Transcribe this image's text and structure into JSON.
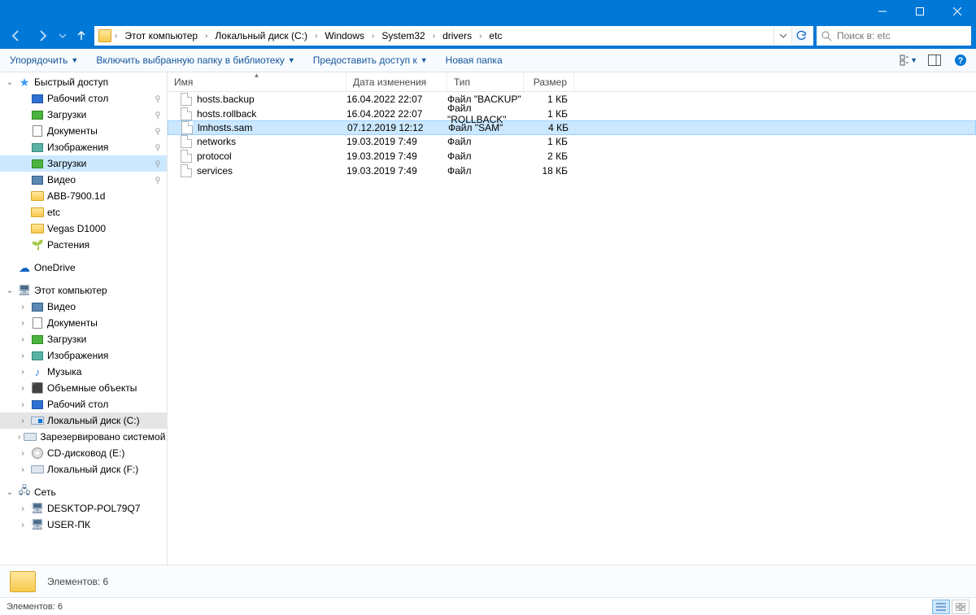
{
  "window": {
    "title": ""
  },
  "breadcrumb": {
    "items": [
      "Этот компьютер",
      "Локальный диск (C:)",
      "Windows",
      "System32",
      "drivers",
      "etc"
    ]
  },
  "search": {
    "placeholder": "Поиск в: etc"
  },
  "toolbar": {
    "organize": "Упорядочить",
    "library": "Включить выбранную папку в библиотеку",
    "share": "Предоставить доступ к",
    "newfolder": "Новая папка"
  },
  "columns": {
    "name": "Имя",
    "date": "Дата изменения",
    "type": "Тип",
    "size": "Размер"
  },
  "files": [
    {
      "name": "hosts.backup",
      "date": "16.04.2022 22:07",
      "type": "Файл \"BACKUP\"",
      "size": "1 КБ",
      "selected": false
    },
    {
      "name": "hosts.rollback",
      "date": "16.04.2022 22:07",
      "type": "Файл \"ROLLBACK\"",
      "size": "1 КБ",
      "selected": false
    },
    {
      "name": "lmhosts.sam",
      "date": "07.12.2019 12:12",
      "type": "Файл \"SAM\"",
      "size": "4 КБ",
      "selected": true
    },
    {
      "name": "networks",
      "date": "19.03.2019 7:49",
      "type": "Файл",
      "size": "1 КБ",
      "selected": false
    },
    {
      "name": "protocol",
      "date": "19.03.2019 7:49",
      "type": "Файл",
      "size": "2 КБ",
      "selected": false
    },
    {
      "name": "services",
      "date": "19.03.2019 7:49",
      "type": "Файл",
      "size": "18 КБ",
      "selected": false
    }
  ],
  "sidebar": {
    "quick": {
      "label": "Быстрый доступ",
      "items": [
        {
          "label": "Рабочий стол",
          "icon": "blue",
          "pin": true
        },
        {
          "label": "Загрузки",
          "icon": "green",
          "pin": true
        },
        {
          "label": "Документы",
          "icon": "doc",
          "pin": true
        },
        {
          "label": "Изображения",
          "icon": "pic",
          "pin": true
        },
        {
          "label": "Загрузки",
          "icon": "green",
          "pin": true,
          "selected": true
        },
        {
          "label": "Видео",
          "icon": "video",
          "pin": true
        },
        {
          "label": "ABB-7900.1d",
          "icon": "folder",
          "pin": false
        },
        {
          "label": "etc",
          "icon": "folder",
          "pin": false
        },
        {
          "label": "Vegas D1000",
          "icon": "folder",
          "pin": false
        },
        {
          "label": "Растения",
          "icon": "plant",
          "pin": false
        }
      ]
    },
    "onedrive": {
      "label": "OneDrive"
    },
    "thispc": {
      "label": "Этот компьютер",
      "items": [
        {
          "label": "Видео",
          "icon": "video"
        },
        {
          "label": "Документы",
          "icon": "doc"
        },
        {
          "label": "Загрузки",
          "icon": "green"
        },
        {
          "label": "Изображения",
          "icon": "pic"
        },
        {
          "label": "Музыка",
          "icon": "music"
        },
        {
          "label": "Объемные объекты",
          "icon": "cube"
        },
        {
          "label": "Рабочий стол",
          "icon": "blue"
        },
        {
          "label": "Локальный диск (C:)",
          "icon": "drive-win",
          "selected": true
        },
        {
          "label": "Зарезервировано системой (D:)",
          "icon": "drive"
        },
        {
          "label": "CD-дисковод (E:)",
          "icon": "cd"
        },
        {
          "label": "Локальный диск (F:)",
          "icon": "drive"
        }
      ]
    },
    "network": {
      "label": "Сеть",
      "items": [
        {
          "label": "DESKTOP-POL79Q7",
          "icon": "pc"
        },
        {
          "label": "USER-ПК",
          "icon": "pc"
        }
      ]
    }
  },
  "infobar": {
    "count_label": "Элементов: 6"
  },
  "status": {
    "count_label": "Элементов: 6"
  }
}
